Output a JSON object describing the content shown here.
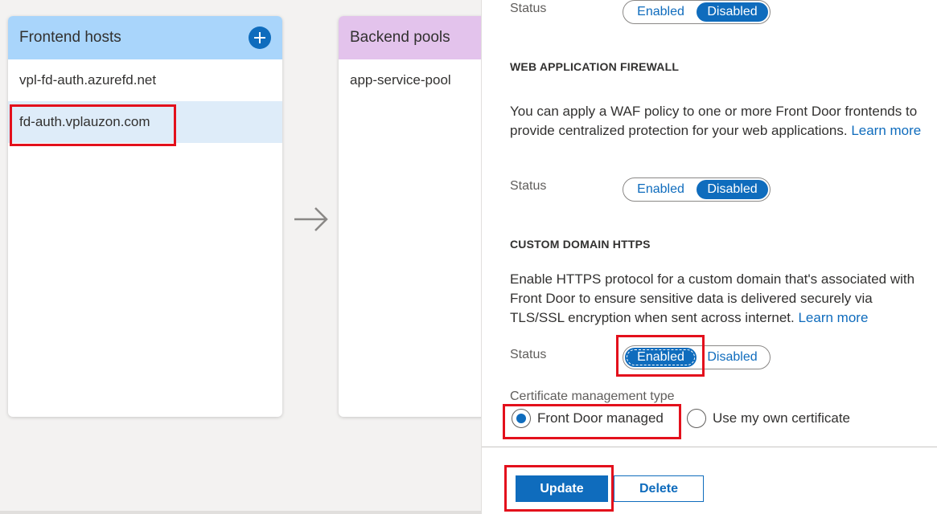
{
  "canvas": {
    "frontend": {
      "title": "Frontend hosts",
      "items": [
        "vpl-fd-auth.azurefd.net",
        "fd-auth.vplauzon.com"
      ],
      "selected_index": 1
    },
    "backend": {
      "title": "Backend pools",
      "items": [
        "app-service-pool"
      ]
    }
  },
  "panel": {
    "top_status": {
      "label": "Status",
      "enabled": "Enabled",
      "disabled": "Disabled",
      "value": "Disabled"
    },
    "waf": {
      "title": "WEB APPLICATION FIREWALL",
      "description": "You can apply a WAF policy to one or more Front Door frontends to provide centralized protection for your web applications.",
      "link": "Learn more",
      "status_label": "Status",
      "enabled": "Enabled",
      "disabled": "Disabled",
      "value": "Disabled"
    },
    "https": {
      "title": "CUSTOM DOMAIN HTTPS",
      "description": "Enable HTTPS protocol for a custom domain that's associated with Front Door to ensure sensitive data is delivered securely via TLS/SSL encryption when sent across internet.",
      "link": "Learn more",
      "status_label": "Status",
      "enabled": "Enabled",
      "disabled": "Disabled",
      "value": "Enabled"
    },
    "certificate": {
      "label": "Certificate management type",
      "options": [
        "Front Door managed",
        "Use my own certificate"
      ],
      "selected": "Front Door managed"
    },
    "footer": {
      "update": "Update",
      "delete": "Delete"
    }
  },
  "colors": {
    "accent": "#0f6cbd",
    "highlight": "#e3101c",
    "frontend_header": "#a9d5fb",
    "backend_header": "#e3c3ec"
  }
}
